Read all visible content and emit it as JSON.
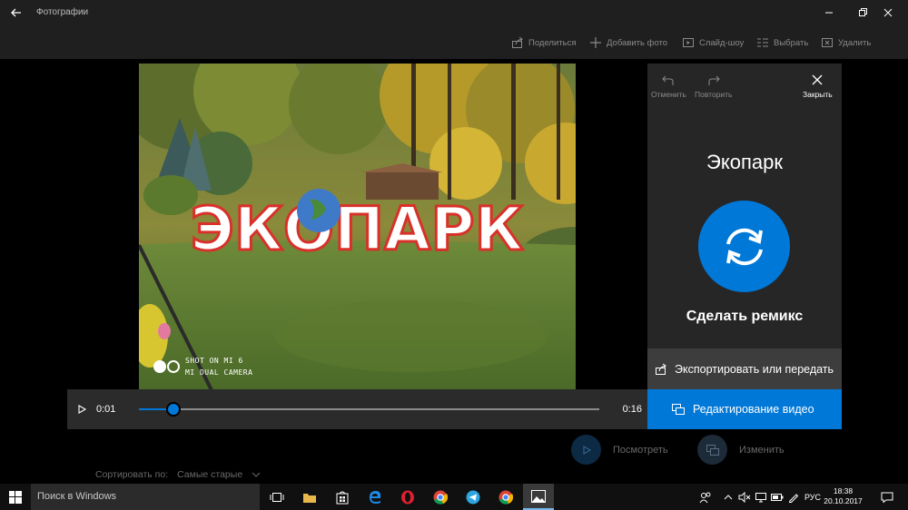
{
  "titlebar": {
    "app_title": "Фотографии"
  },
  "commands": [
    {
      "label": "Поделиться",
      "icon": "share-icon"
    },
    {
      "label": "Добавить фото",
      "icon": "plus-icon"
    },
    {
      "label": "Слайд-шоу",
      "icon": "slideshow-icon"
    },
    {
      "label": "Выбрать",
      "icon": "select-icon"
    },
    {
      "label": "Удалить",
      "icon": "delete-icon"
    }
  ],
  "photo": {
    "sign_text": "ЭКОПАРК",
    "watermark_line1": "SHOT ON MI 6",
    "watermark_line2": "MI DUAL CAMERA"
  },
  "player": {
    "current_time": "0:01",
    "total_time": "0:16",
    "progress": 0.075
  },
  "panel": {
    "undo_label": "Отменить",
    "redo_label": "Повторить",
    "close_label": "Закрыть",
    "title": "Экопарк",
    "remix_label": "Сделать ремикс",
    "export_label": "Экспортировать или передать",
    "edit_video_label": "Редактирование видео"
  },
  "bottom": {
    "watch_label": "Посмотреть",
    "change_label": "Изменить",
    "sort_label": "Сортировать по:",
    "sort_value": "Самые старые"
  },
  "taskbar": {
    "search_placeholder": "Поиск в Windows",
    "lang": "РУС",
    "time": "18:38",
    "date": "20.10.2017"
  },
  "colors": {
    "accent": "#0078d7",
    "panel": "#262626",
    "bar": "#1f1f1f"
  }
}
